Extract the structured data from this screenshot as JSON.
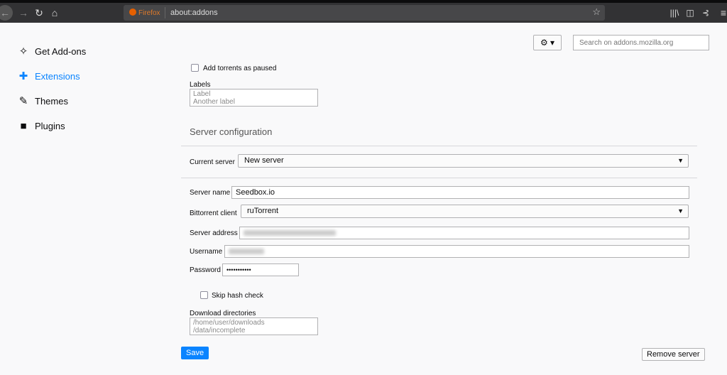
{
  "browser": {
    "brand": "Firefox",
    "url": "about:addons"
  },
  "sidebar": {
    "items": [
      {
        "label": "Get Add-ons",
        "icon": "puzzle-sparkle-icon"
      },
      {
        "label": "Extensions",
        "icon": "puzzle-icon",
        "active": true
      },
      {
        "label": "Themes",
        "icon": "brush-icon"
      },
      {
        "label": "Plugins",
        "icon": "plugin-icon"
      }
    ]
  },
  "header": {
    "search_placeholder": "Search on addons.mozilla.org",
    "gear": "⚙ ▾"
  },
  "form": {
    "add_paused": "Add torrents as paused",
    "labels_label": "Labels",
    "labels_value": "Label\nAnother label",
    "server_config_title": "Server configuration",
    "current_server_label": "Current server",
    "current_server_value": "New server",
    "server_name_label": "Server name",
    "server_name_value": "Seedbox.io",
    "client_label": "Bittorrent client",
    "client_value": "ruTorrent",
    "address_label": "Server address",
    "username_label": "Username",
    "password_label": "Password",
    "password_value": "•••••••••••",
    "skip_hash": "Skip hash check",
    "download_dirs_label": "Download directories",
    "download_dirs_value": "/home/user/downloads\n/data/incomplete",
    "save": "Save",
    "remove": "Remove server"
  },
  "colors": {
    "accent": "#0a84ff"
  }
}
